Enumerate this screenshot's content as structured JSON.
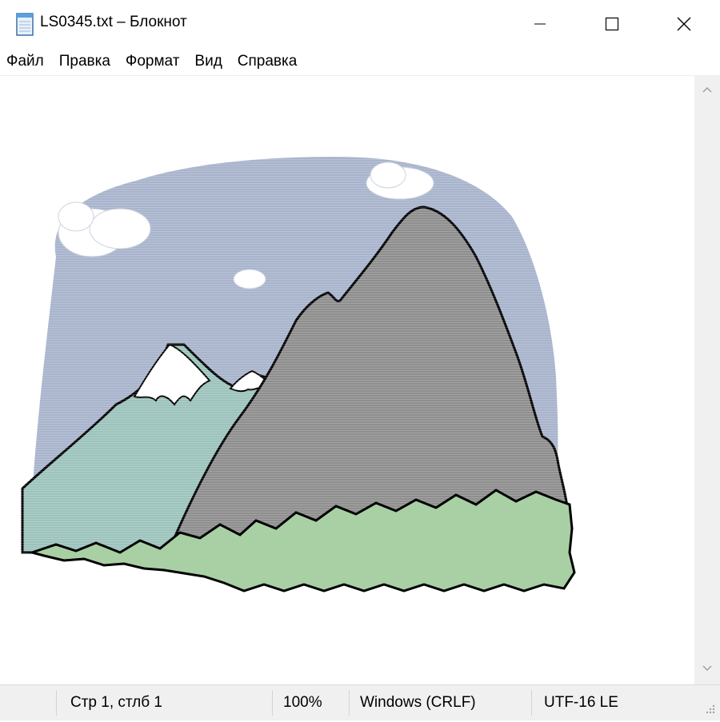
{
  "window": {
    "title": "LS0345.txt – Блокнот",
    "icon": "notepad-icon",
    "controls": [
      "minimize-icon",
      "maximize-icon",
      "close-icon"
    ]
  },
  "menu": {
    "items": [
      {
        "label": "Файл"
      },
      {
        "label": "Правка"
      },
      {
        "label": "Формат"
      },
      {
        "label": "Вид"
      },
      {
        "label": "Справка"
      }
    ]
  },
  "status": {
    "position": "Стр 1, стлб 1",
    "zoom": "100%",
    "line_endings": "Windows (CRLF)",
    "encoding": "UTF-16 LE"
  },
  "colors": {
    "sky": "#a8b4cc",
    "left_mountain": "#9cc3bc",
    "big_mountain": "#8e8e8e",
    "grass": "#a8d0a4",
    "snow": "#ffffff",
    "outline": "#000000",
    "status_bar": "#f0f0f0"
  }
}
